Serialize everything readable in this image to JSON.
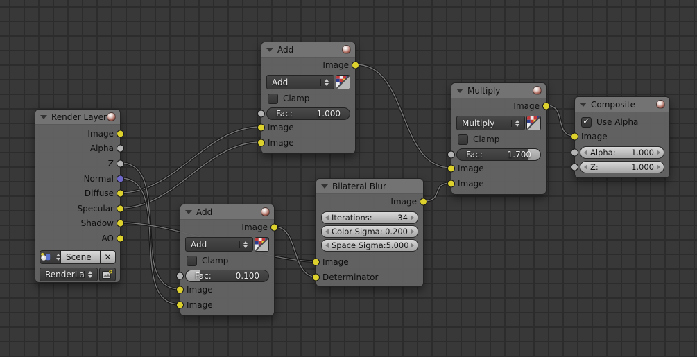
{
  "colors": {
    "background": "#383838",
    "grid_line": "#2c2c2c",
    "node_body": "#646464",
    "node_header": "#747474",
    "widget_dark": "#3f3f3f",
    "field_light": "#c6c6c6",
    "socket_yellow": "#ddd12d",
    "socket_gray": "#b4b4b4",
    "socket_blue": "#6d68c9",
    "slider_fill": "#b0b0b0",
    "wire_outer": "#161616",
    "wire_inner": "#777777"
  },
  "nodes": {
    "render_layers": {
      "title": "Render Layers",
      "outputs": [
        "Image",
        "Alpha",
        "Z",
        "Normal",
        "Diffuse",
        "Specular",
        "Shadow",
        "AO"
      ],
      "scene_value": "Scene",
      "layer_value": "RenderLayer"
    },
    "add_1": {
      "title": "Add",
      "output": "Image",
      "blend": "Add",
      "clamp": "Clamp",
      "clamp_checked": false,
      "fac_label": "Fac:",
      "fac_value": "1.000",
      "fac_fill": {
        "from": 0,
        "to": 0
      },
      "inputs": [
        "Image",
        "Image"
      ]
    },
    "add_2": {
      "title": "Add",
      "output": "Image",
      "blend": "Add",
      "clamp": "Clamp",
      "clamp_checked": false,
      "fac_label": "Fac:",
      "fac_value": "0.100",
      "fac_fill": {
        "from": 0,
        "to": 18
      },
      "inputs": [
        "Image",
        "Image"
      ]
    },
    "bilateral_blur": {
      "title": "Bilateral Blur",
      "output": "Image",
      "fields": [
        {
          "label": "Iterations:",
          "value": "34"
        },
        {
          "label": "Color Sigma:",
          "value": "0.200"
        },
        {
          "label": "Space Sigma:",
          "value": "5.000"
        }
      ],
      "inputs": [
        "Image",
        "Determinator"
      ]
    },
    "multiply": {
      "title": "Multiply",
      "output": "Image",
      "blend": "Multiply",
      "clamp": "Clamp",
      "clamp_checked": false,
      "fac_label": "Fac:",
      "fac_value": "1.700",
      "fac_fill": {
        "from": 85,
        "to": 100
      },
      "inputs": [
        "Image",
        "Image"
      ]
    },
    "composite": {
      "title": "Composite",
      "use_alpha": "Use Alpha",
      "use_alpha_checked": true,
      "input": "Image",
      "fields": [
        {
          "label": "Alpha:",
          "value": "1.000"
        },
        {
          "label": "Z:",
          "value": "1.000"
        }
      ]
    }
  },
  "wires": [
    {
      "from": "render-layers/Diffuse",
      "to": "add-1/Image-1",
      "path": [
        174,
        278,
        376,
        183
      ]
    },
    {
      "from": "render-layers/Specular",
      "to": "add-1/Image-2",
      "path": [
        174,
        300,
        376,
        205
      ]
    },
    {
      "from": "render-layers/Z",
      "to": "add-2/Image-1",
      "path": [
        174,
        235,
        259,
        417
      ]
    },
    {
      "from": "render-layers/Normal",
      "to": "add-2/Image-2",
      "path": [
        174,
        257,
        259,
        439
      ]
    },
    {
      "from": "render-layers/Shadow",
      "to": "bilateral-blur/Image",
      "path": [
        174,
        321,
        455,
        377
      ]
    },
    {
      "from": "add-2/Image",
      "to": "bilateral-blur/Determinator",
      "path": [
        396,
        327,
        455,
        399
      ]
    },
    {
      "from": "add-1/Image",
      "to": "multiply/Image-1",
      "path": [
        513,
        93,
        650,
        242
      ]
    },
    {
      "from": "bilateral-blur/Image",
      "to": "multiply/Image-2",
      "path": [
        611,
        290,
        650,
        264
      ]
    },
    {
      "from": "multiply/Image",
      "to": "composite/Image",
      "path": [
        788,
        152,
        828,
        196
      ]
    }
  ]
}
